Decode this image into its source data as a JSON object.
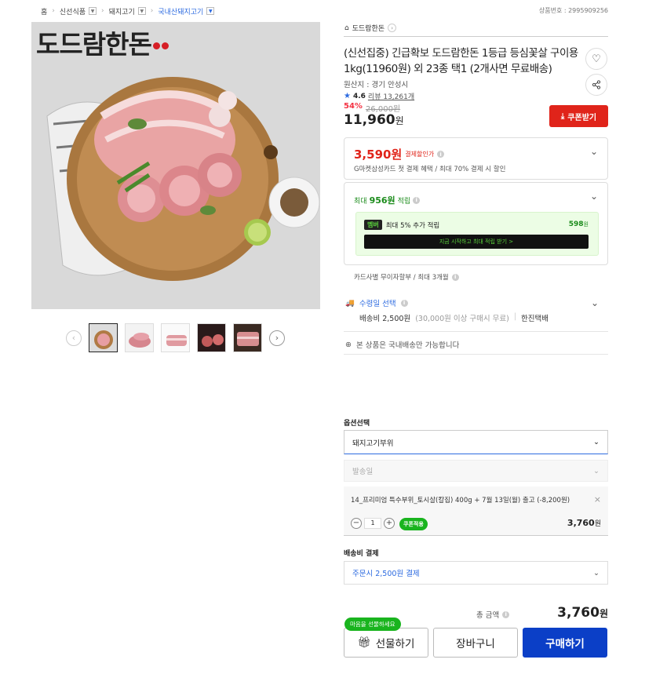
{
  "breadcrumb": [
    {
      "label": "홈"
    },
    {
      "label": "신선식품"
    },
    {
      "label": "돼지고기"
    },
    {
      "label": "국내산돼지고기"
    }
  ],
  "product_no": "상품번호 : 2995909256",
  "gallery": {
    "brand_logo": "도드람한돈"
  },
  "shop": {
    "name": "도드람한돈"
  },
  "product": {
    "title": "(신선집중) 긴급확보 도드람한돈 1등급 등심꽃살 구이용 1kg(11960원) 외 23종 택1 (2개사면 무료배송)",
    "origin": "원산지 : 경기 안성시",
    "rating": "4.6",
    "reviews": "리뷰 13,261개",
    "discount_pct": "54%",
    "original_price": "26,000원",
    "price": "11,960",
    "price_unit": "원",
    "coupon_label": "쿠폰받기"
  },
  "benefits": {
    "card_price": "3,590원",
    "card_price_label": "결제할인가",
    "card_desc": "G마켓삼성카드 첫 결제 혜택 / 최대 70% 결제 시 할인",
    "points_prefix": "최대",
    "points_value": "956원",
    "points_suffix": "적립",
    "club_badge": "멤버",
    "club_text": "최대 5% 추가 적립",
    "club_points": "598",
    "club_points_unit": "원",
    "club_button": "지금 시작하고 최대 적립 받기 >",
    "installment": "카드사별 무이자할부 / 최대 3개월"
  },
  "shipping": {
    "label": "수령일 선택",
    "fee": "배송비 2,500원",
    "fee_cond": "(30,000원 이상 구매시 무료)",
    "courier": "한진택배",
    "domestic": "본 상품은 국내배송만 가능합니다"
  },
  "options": {
    "title": "옵션선택",
    "select1": "돼지고기부위",
    "select2": "발송일",
    "selected_name": "14_프리미엄 특수부위_토시살(칼집) 400g + 7월 13일(월) 출고 (-8,200원)",
    "qty": "1",
    "coupon_tag": "쿠폰적용",
    "item_price": "3,760",
    "item_price_unit": "원"
  },
  "shipping_payment": {
    "title": "배송비 결제",
    "value": "주문시 2,500원 결제"
  },
  "total": {
    "label": "총 금액",
    "value": "3,760",
    "unit": "원"
  },
  "actions": {
    "gift_bubble": "마음을 선물하세요",
    "gift": "선물하기",
    "cart": "장바구니",
    "buy": "구매하기"
  },
  "colors": {
    "accent_red": "#e0241a",
    "accent_blue": "#0b3fc7",
    "accent_green": "#19b41e",
    "link_blue": "#2d6be0"
  }
}
